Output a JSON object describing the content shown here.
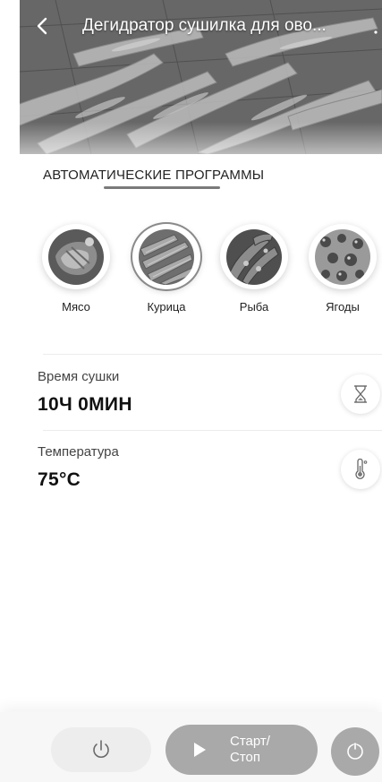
{
  "header": {
    "title": "Дегидратор сушилка для ово...",
    "back_icon": "chevron-left-icon",
    "more_icon": "more-vertical-icon"
  },
  "programs": {
    "section_title": "АВТОМАТИЧЕСКИЕ ПРОГРАММЫ",
    "selected_index": 1,
    "items": [
      {
        "label": "Мясо",
        "icon": "meat-photo"
      },
      {
        "label": "Курица",
        "icon": "chicken-photo"
      },
      {
        "label": "Рыба",
        "icon": "fish-photo"
      },
      {
        "label": "Ягоды",
        "icon": "berries-photo"
      }
    ]
  },
  "settings": {
    "drying_time": {
      "label": "Время сушки",
      "value": "10Ч 0МИН",
      "icon": "hourglass-icon"
    },
    "temperature": {
      "label": "Температура",
      "value": "75°C",
      "icon": "thermometer-icon"
    }
  },
  "bottom_bar": {
    "power_icon": "power-icon",
    "start_stop_label_line1": "Старт/",
    "start_stop_label_line2": "Стоп",
    "play_icon": "play-icon",
    "timer_icon": "timer-icon"
  },
  "colors": {
    "button_gray": "#a9a9a9",
    "power_bg": "#ededed",
    "bar_bg": "#f7f7f7",
    "text_dark": "#111111"
  }
}
